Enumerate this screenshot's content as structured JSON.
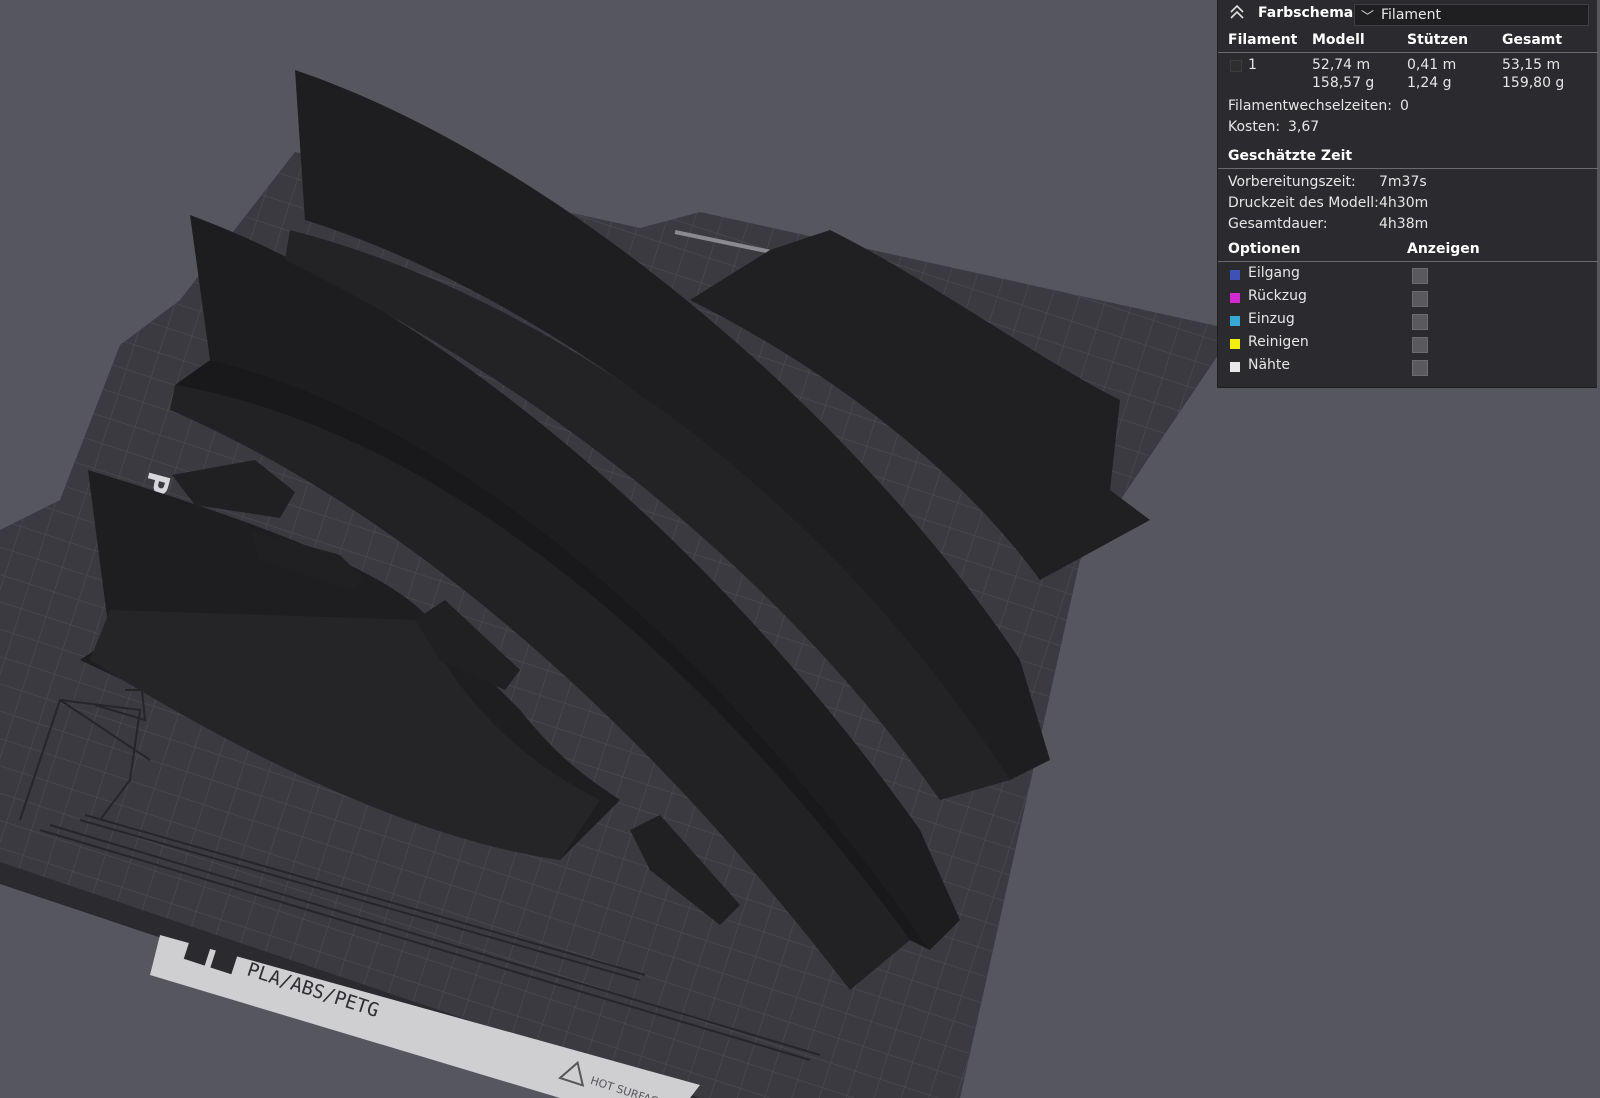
{
  "plate": {
    "brand_text": "Plate",
    "material_label": "PLA/ABS/PETG",
    "warning_label": "HOT SURFACE"
  },
  "colors": {
    "background": "#56565e",
    "plate": "#3a3a40",
    "model": "#1f1f21",
    "panel": "#2b2b2f"
  },
  "legend": {
    "collapse_icon": "chevron-up-double-icon",
    "title": "Farbschema",
    "scheme_value": "Filament",
    "columns": [
      "Filament",
      "Modell",
      "Stützen",
      "Gesamt"
    ],
    "filament_row": {
      "id": "1",
      "swatch_color": "#2e2e2e",
      "model_length": "52,74 m",
      "model_weight": "158,57 g",
      "support_length": "0,41 m",
      "support_weight": "1,24 g",
      "total_length": "53,15 m",
      "total_weight": "159,80 g"
    },
    "filament_change_label": "Filamentwechselzeiten:",
    "filament_change_value": "0",
    "cost_label": "Kosten:",
    "cost_value": "3,67",
    "time_heading": "Geschätzte Zeit",
    "prep_label": "Vorbereitungszeit:",
    "prep_value": "7m37s",
    "model_time_label": "Druckzeit des Modell:",
    "model_time_value": "4h30m",
    "total_time_label": "Gesamtdauer:",
    "total_time_value": "4h38m",
    "options_heading": "Optionen",
    "show_heading": "Anzeigen",
    "options": [
      {
        "label": "Eilgang",
        "color": "#3f51b5",
        "checked": false
      },
      {
        "label": "Rückzug",
        "color": "#d22ad2",
        "checked": false
      },
      {
        "label": "Einzug",
        "color": "#37a7d6",
        "checked": false
      },
      {
        "label": "Reinigen",
        "color": "#f2ee12",
        "checked": false
      },
      {
        "label": "Nähte",
        "color": "#e8e8e8",
        "checked": false
      }
    ]
  }
}
